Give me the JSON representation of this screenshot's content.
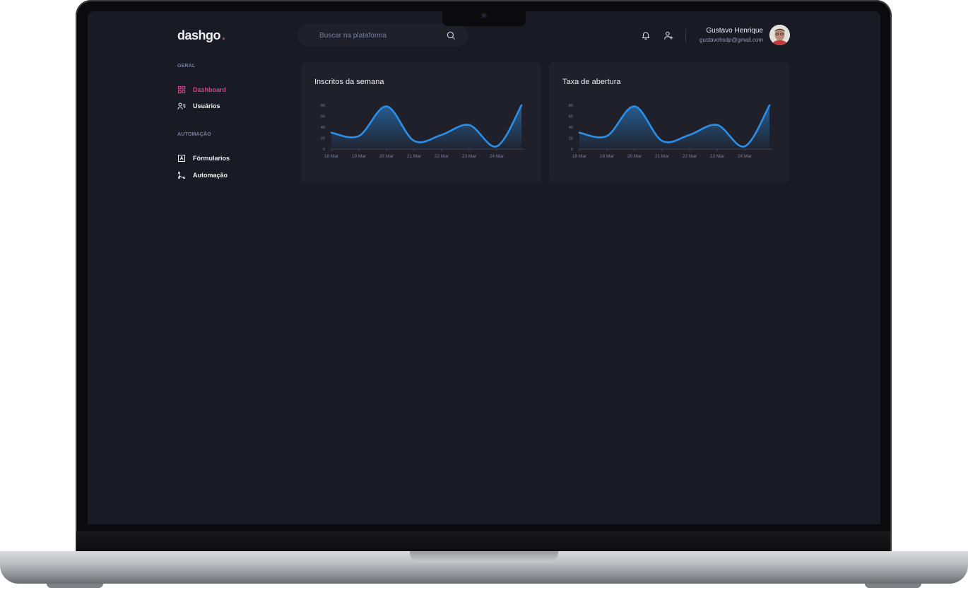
{
  "app": {
    "logo_text": "dashgo",
    "logo_dot": ".",
    "accent_color": "#d53f8c"
  },
  "search": {
    "placeholder": "Buscar na plataforma",
    "icon": "search-icon"
  },
  "header": {
    "notification_icon": "bell-icon",
    "add_user_icon": "user-plus-icon",
    "profile": {
      "name": "Gustavo Henrique",
      "email": "gustavohsdp@gmail.com"
    }
  },
  "sidebar": {
    "sections": [
      {
        "title": "GERAL",
        "items": [
          {
            "label": "Dashboard",
            "icon": "dashboard-grid-icon",
            "active": true
          },
          {
            "label": "Usuários",
            "icon": "users-list-icon",
            "active": false
          }
        ]
      },
      {
        "title": "AUTOMAÇÃO",
        "items": [
          {
            "label": "Fórmularios",
            "icon": "form-icon",
            "active": false
          },
          {
            "label": "Automação",
            "icon": "git-branch-icon",
            "active": false
          }
        ]
      }
    ]
  },
  "charts": [
    {
      "title": "Inscritos da semana"
    },
    {
      "title": "Taxa de abertura"
    }
  ],
  "chart_data": [
    {
      "type": "area",
      "title": "Inscritos da semana",
      "categories": [
        "18 Mar",
        "19 Mar",
        "20 Mar",
        "21 Mar",
        "22 Mar",
        "23 Mar",
        "24 Mar"
      ],
      "x": [
        0,
        1,
        2,
        3,
        4,
        5,
        6,
        6.9
      ],
      "y": [
        30,
        24,
        78,
        15,
        26,
        44,
        5,
        80
      ],
      "y_ticks": [
        "0",
        "20",
        "40",
        "60",
        "80"
      ],
      "ylim": [
        0,
        80
      ],
      "series_color": "#2b8fe8",
      "grid": false,
      "legend": false
    },
    {
      "type": "area",
      "title": "Taxa de abertura",
      "categories": [
        "18 Mar",
        "19 Mar",
        "20 Mar",
        "21 Mar",
        "22 Mar",
        "23 Mar",
        "24 Mar"
      ],
      "x": [
        0,
        1,
        2,
        3,
        4,
        5,
        6,
        6.9
      ],
      "y": [
        30,
        24,
        78,
        15,
        26,
        44,
        5,
        80
      ],
      "y_ticks": [
        "0",
        "20",
        "40",
        "60",
        "80"
      ],
      "ylim": [
        0,
        80
      ],
      "series_color": "#2b8fe8",
      "grid": false,
      "legend": false
    }
  ]
}
